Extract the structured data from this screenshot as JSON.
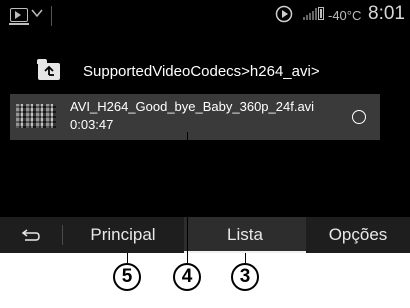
{
  "statusbar": {
    "source_icon": "source-menu-icon",
    "chevron_icon": "chevron-down-icon",
    "playback_icon": "play-circle-icon",
    "signal_icon": "signal-icon",
    "battery_icon": "battery-icon",
    "temperature": "-40°C",
    "time": "8:01"
  },
  "browser": {
    "up_icon": "folder-up-icon",
    "path": "SupportedVideoCodecs>h264_avi>",
    "files": [
      {
        "name": "AVI_H264_Good_bye_Baby_360p_24f.avi",
        "duration": "0:03:47",
        "thumbnail_icon": "video-thumbnail",
        "selected": false
      }
    ]
  },
  "bottombar": {
    "back_icon": "back-arrow-icon",
    "principal": "Principal",
    "lista": "Lista",
    "opcoes": "Opções",
    "active_tab": "Lista"
  },
  "callouts": [
    "5",
    "4",
    "3"
  ]
}
